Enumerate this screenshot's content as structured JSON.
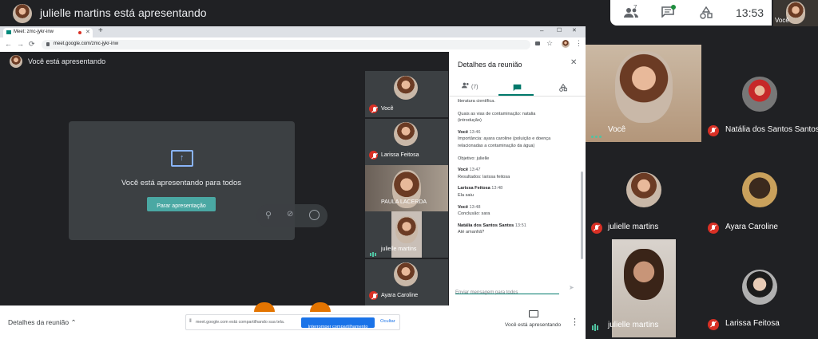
{
  "top": {
    "title": "julielle martins está apresentando",
    "time": "13:53",
    "self_label": "Você",
    "people_count": "7"
  },
  "browser": {
    "tab_title": "Meet: zmc-jykr-inw",
    "new_tab": "+",
    "url": "meet.google.com/zmc-jykr-inw",
    "min": "–",
    "max": "☐",
    "close": "✕"
  },
  "inner": {
    "header": "Você está apresentando",
    "present_title": "Você está apresentando para todos",
    "stop_button": "Parar apresentação",
    "tiles": [
      {
        "name": "Você"
      },
      {
        "name": "Larissa Feitosa"
      },
      {
        "name": "PAULA LACERDA"
      },
      {
        "name": "julielle martins"
      },
      {
        "name": "Ayara Caroline"
      }
    ],
    "footer_details": "Detalhes da reunião",
    "footer_presenting": "Você está apresentando",
    "share_banner": {
      "text": "meet.google.com está compartilhando sua tela.",
      "stop": "Interromper compartilhamento",
      "hide": "Ocultar"
    }
  },
  "details": {
    "title": "Detalhes da reunião",
    "people_tab": "(7)",
    "messages": [
      {
        "sender": "",
        "time": "",
        "lines": [
          "literatura científica.",
          "",
          "Quais as vias de contaminação: natalia",
          "(introdução)"
        ]
      },
      {
        "sender": "Você",
        "time": "13:46",
        "lines": [
          "Importância: ayara caroline (poluição e doença",
          "relacionadas a contaminação da água)",
          "",
          "Objetivo: julielle"
        ]
      },
      {
        "sender": "Você",
        "time": "13:47",
        "lines": [
          "Resultados: larissa feitosa"
        ]
      },
      {
        "sender": "Larissa Feitosa",
        "time": "13:48",
        "lines": [
          "Ela saiu"
        ]
      },
      {
        "sender": "Você",
        "time": "13:48",
        "lines": [
          "Conclusão: sara"
        ]
      },
      {
        "sender": "Natália dos Santos Santos",
        "time": "13:51",
        "lines": [
          "Até amanhã?"
        ]
      }
    ],
    "input_placeholder": "Enviar mensagem para todos"
  },
  "grid": [
    {
      "name": "Você",
      "status": "speaking"
    },
    {
      "name": "Natália dos Santos Santos",
      "status": "muted"
    },
    {
      "name": "julielle martins",
      "status": "muted"
    },
    {
      "name": "Ayara Caroline",
      "status": "muted"
    },
    {
      "name": "julielle martins",
      "status": "speaking"
    },
    {
      "name": "Larissa Feitosa",
      "status": "muted"
    }
  ]
}
